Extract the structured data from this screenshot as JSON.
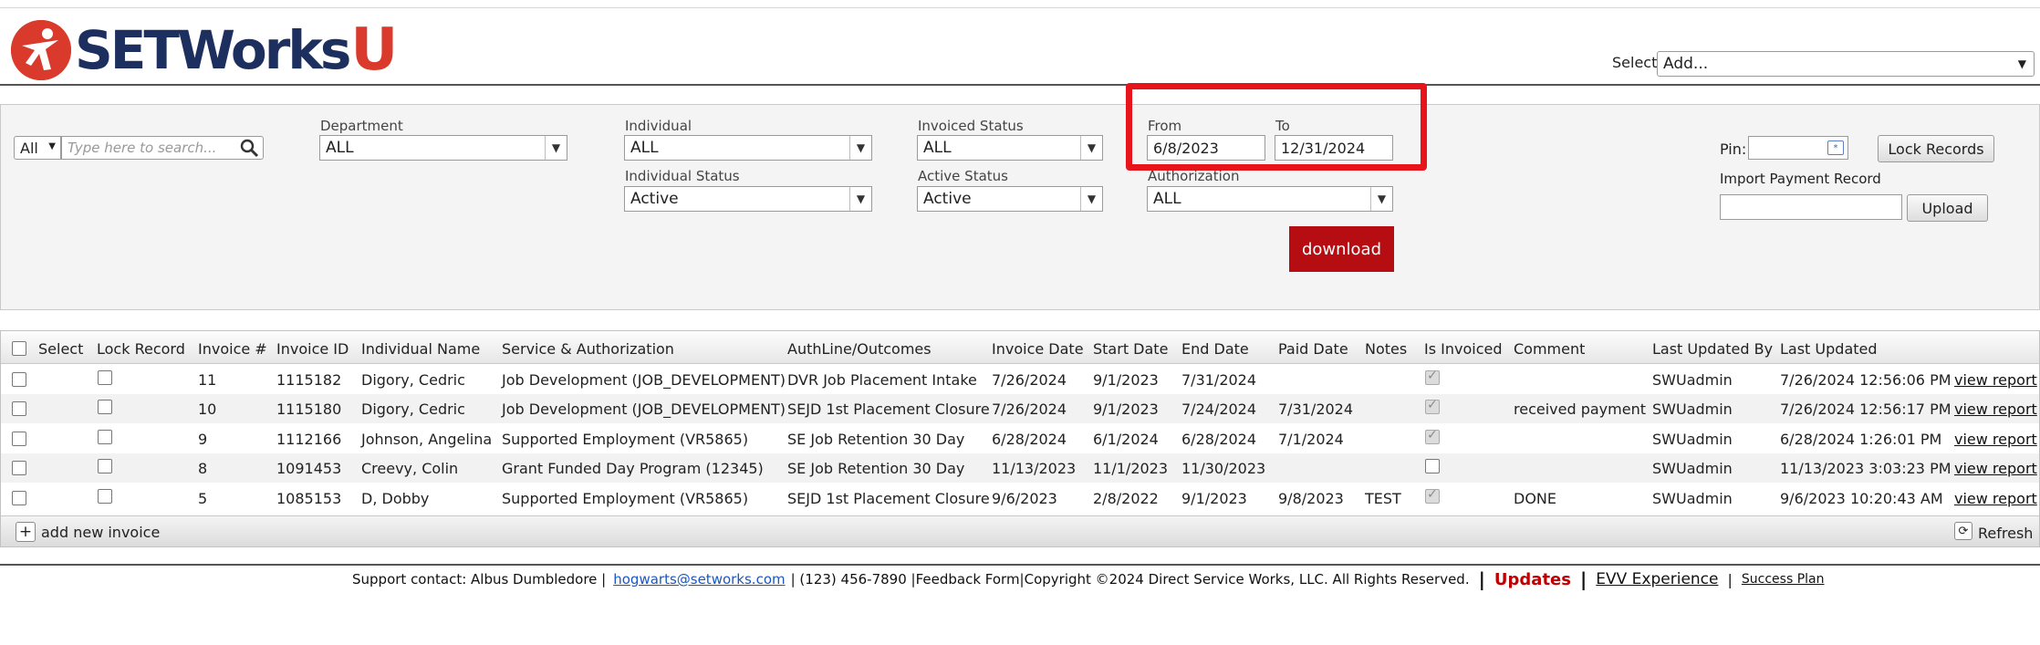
{
  "logo": {
    "text": "SETWorks",
    "accent": "U",
    "brand_blue": "#1d2f5e",
    "brand_red": "#d93a2b"
  },
  "header": {
    "select_label": "Select:",
    "select_value": "Add..."
  },
  "filters": {
    "search_mode": "All",
    "search_placeholder": "Type here to search...",
    "department_label": "Department",
    "department_value": "ALL",
    "individual_label": "Individual",
    "individual_value": "ALL",
    "individual_status_label": "Individual Status",
    "individual_status_value": "Active",
    "invoiced_status_label": "Invoiced Status",
    "invoiced_status_value": "ALL",
    "active_status_label": "Active Status",
    "active_status_value": "Active",
    "from_label": "From",
    "from_value": "6/8/2023",
    "to_label": "To",
    "to_value": "12/31/2024",
    "authorization_label": "Authorization",
    "authorization_value": "ALL",
    "download_label": "download",
    "pin_label": "Pin:",
    "lock_records_label": "Lock Records",
    "import_label": "Import Payment Record",
    "upload_label": "Upload"
  },
  "grid": {
    "columns": [
      "Select",
      "Lock Record",
      "Invoice #",
      "Invoice ID",
      "Individual Name",
      "Service & Authorization",
      "AuthLine/Outcomes",
      "Invoice Date",
      "Start Date",
      "End Date",
      "Paid Date",
      "Notes",
      "Is Invoiced",
      "Comment",
      "Last Updated By",
      "Last Updated"
    ],
    "rows": [
      {
        "invoice_no": "11",
        "invoice_id": "1115182",
        "name": "Digory, Cedric",
        "service": "Job Development (JOB_DEVELOPMENT)",
        "authline": "DVR Job Placement Intake",
        "invoice_date": "7/26/2024",
        "start_date": "9/1/2023",
        "end_date": "7/31/2024",
        "paid_date": "",
        "notes": "",
        "is_invoiced": true,
        "comment": "",
        "updated_by": "SWUadmin",
        "updated": "7/26/2024 12:56:06 PM",
        "action": "view report"
      },
      {
        "invoice_no": "10",
        "invoice_id": "1115180",
        "name": "Digory, Cedric",
        "service": "Job Development (JOB_DEVELOPMENT)",
        "authline": "SEJD 1st Placement Closure",
        "invoice_date": "7/26/2024",
        "start_date": "9/1/2023",
        "end_date": "7/24/2024",
        "paid_date": "7/31/2024",
        "notes": "",
        "is_invoiced": true,
        "comment": "received payment",
        "updated_by": "SWUadmin",
        "updated": "7/26/2024 12:56:17 PM",
        "action": "view report"
      },
      {
        "invoice_no": "9",
        "invoice_id": "1112166",
        "name": "Johnson, Angelina",
        "service": "Supported Employment (VR5865)",
        "authline": "SE Job Retention 30 Day",
        "invoice_date": "6/28/2024",
        "start_date": "6/1/2024",
        "end_date": "6/28/2024",
        "paid_date": "7/1/2024",
        "notes": "",
        "is_invoiced": true,
        "comment": "",
        "updated_by": "SWUadmin",
        "updated": "6/28/2024 1:26:01 PM",
        "action": "view report"
      },
      {
        "invoice_no": "8",
        "invoice_id": "1091453",
        "name": "Creevy, Colin",
        "service": "Grant Funded Day Program (12345)",
        "authline": "SE Job Retention 30 Day",
        "invoice_date": "11/13/2023",
        "start_date": "11/1/2023",
        "end_date": "11/30/2023",
        "paid_date": "",
        "notes": "",
        "is_invoiced": false,
        "comment": "",
        "updated_by": "SWUadmin",
        "updated": "11/13/2023 3:03:23 PM",
        "action": "view report"
      },
      {
        "invoice_no": "5",
        "invoice_id": "1085153",
        "name": "D, Dobby",
        "service": "Supported Employment (VR5865)",
        "authline": "SEJD 1st Placement Closure",
        "invoice_date": "9/6/2023",
        "start_date": "2/8/2022",
        "end_date": "9/1/2023",
        "paid_date": "9/8/2023",
        "notes": "TEST",
        "is_invoiced": true,
        "comment": "DONE",
        "updated_by": "SWUadmin",
        "updated": "9/6/2023 10:20:43 AM",
        "action": "view report"
      }
    ],
    "add_label": "add new invoice",
    "refresh_label": "Refresh"
  },
  "footer": {
    "support": "Support contact: Albus Dumbledore |",
    "email": "hogwarts@setworks.com",
    "details": "| (123) 456-7890 |Feedback Form|Copyright ©2024 Direct Service Works, LLC. All Rights Reserved.",
    "bar": "|",
    "updates": "Updates",
    "evv": "EVV Experience",
    "pipe": "|",
    "success": "Success Plan",
    "updates_color": "#c00000",
    "link_color": "#1a56c6"
  }
}
